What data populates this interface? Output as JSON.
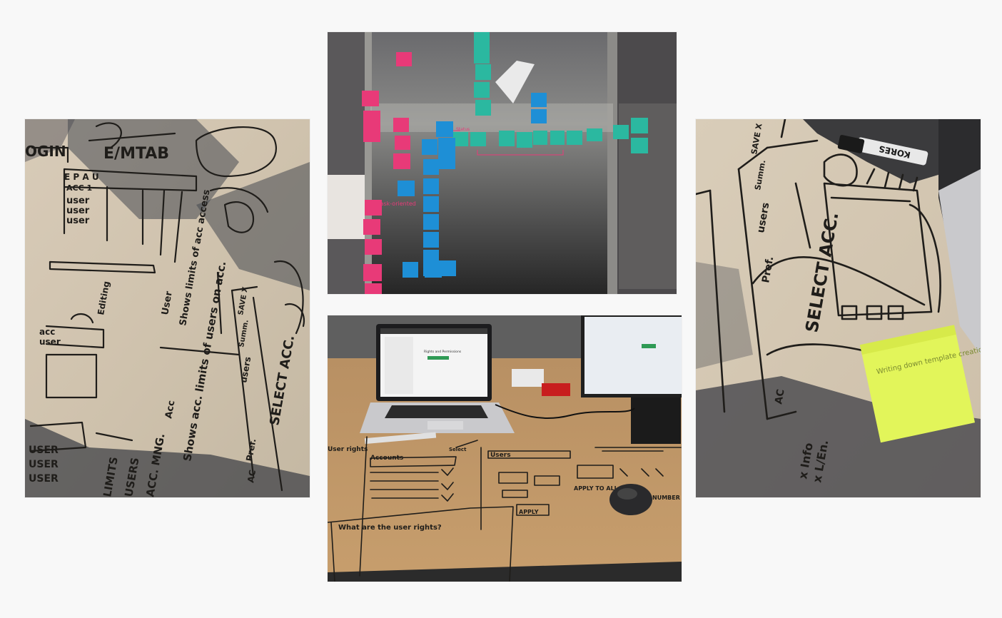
{
  "sketch_left": {
    "labels": {
      "login": "OGIN",
      "tab": "E/MTAB",
      "header_letters": "E P A U",
      "acc": "ACC 1",
      "user1": "user",
      "user2": "user",
      "user3": "user",
      "editing": "Editing",
      "acc_small": "acc",
      "user_small": "user",
      "shows_limits": "Shows limits of acc access",
      "user_heading": "User",
      "shows_acc": "Shows acc. limits of users on acc.",
      "acc_heading": "Acc",
      "pref": "Pref.",
      "users_tab": "users",
      "summ": "Summ.",
      "save": "SAVE X",
      "select_acc": "SELECT ACC.",
      "ac": "AC",
      "limits": "LIMITS",
      "users_big": "USERS",
      "acc_mng": "ACC. MNG.",
      "user_a": "USER",
      "user_b": "USER",
      "user_c": "USER"
    }
  },
  "wall": {
    "labels": {
      "note_a": "Task-oriented",
      "note_b": "Status"
    },
    "colors": {
      "pink": "#e83a78",
      "teal": "#2bb8a0",
      "blue": "#1e8fd6"
    }
  },
  "desk": {
    "labels": {
      "rights": "User rights",
      "accounts": "Accounts",
      "users": "Users",
      "apply": "APPLY",
      "apply_to_all": "APPLY TO ALL",
      "question": "What are the user rights?",
      "select": "Select",
      "number": "NUMBER"
    },
    "screen": {
      "title": "Rights and Permissions"
    }
  },
  "sketch_right": {
    "labels": {
      "pref": "Pref.",
      "users": "users",
      "summ": "Summ.",
      "save": "SAVE X",
      "select_acc": "SELECT ACC.",
      "ac": "AC",
      "xinfo": "x Info",
      "xlen": "x L/En.",
      "marker": "KORES",
      "postit": "Writing down template creation"
    },
    "colors": {
      "postit": "#e2f55a"
    }
  }
}
